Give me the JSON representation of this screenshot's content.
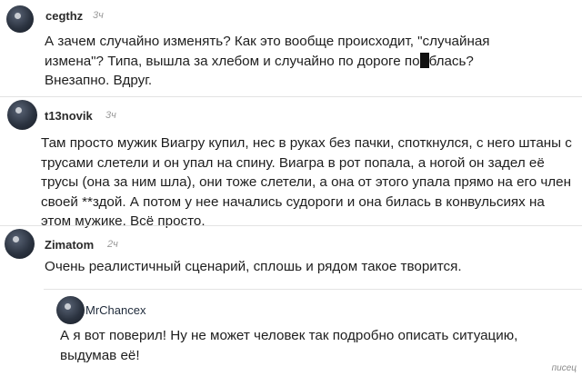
{
  "comments": [
    {
      "username": "cegthz",
      "time": "3ч",
      "text_before": "А зачем случайно изменять? Как это вообще происходит, \"случайная измена\"? Типа, вышла за хлебом и случайно по дороге по",
      "text_after": "блась? Внезапно. Вдруг."
    },
    {
      "username": "t13novik",
      "time": "3ч",
      "text": "Там просто мужик Виагру купил, нес в руках без пачки, споткнулся, с него штаны с трусами слетели и он упал на спину. Виагра в рот попала, а ногой он задел её трусы (она за ним шла), они тоже слетели, а она от этого упала прямо на его член своей **здой. А потом у нее начались судороги и она билась в конвульсиях на этом мужике. Всё просто."
    },
    {
      "username": "Zimatom",
      "time": "2ч",
      "text": "Очень реалистичный сценарий, сплошь и рядом такое творится."
    },
    {
      "username": "MrChancex",
      "text": "А я вот поверил! Ну не может человек так подробно описать ситуацию, выдумав её!"
    }
  ],
  "watermark": "писец"
}
